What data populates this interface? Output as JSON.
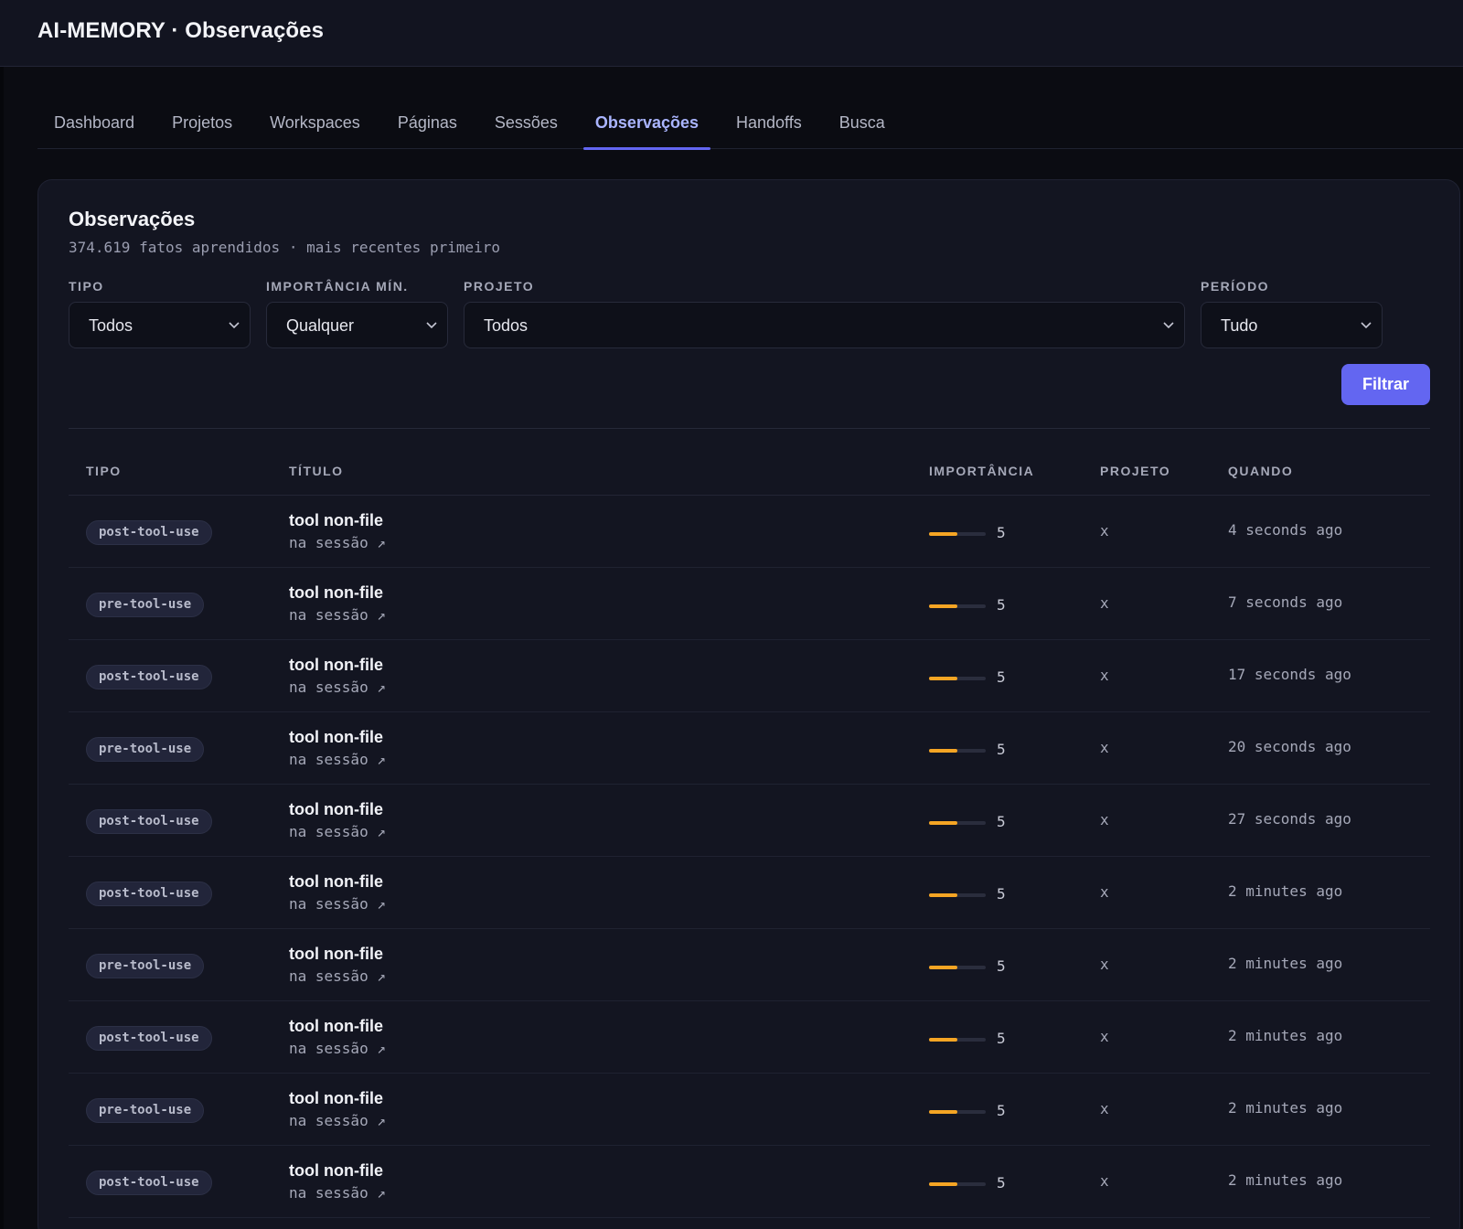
{
  "app": {
    "title": "AI-MEMORY · Observações"
  },
  "tabs": [
    {
      "label": "Dashboard"
    },
    {
      "label": "Projetos"
    },
    {
      "label": "Workspaces"
    },
    {
      "label": "Páginas"
    },
    {
      "label": "Sessões"
    },
    {
      "label": "Observações",
      "active": true
    },
    {
      "label": "Handoffs"
    },
    {
      "label": "Busca"
    }
  ],
  "card": {
    "title": "Observações",
    "subtitle": "374.619 fatos aprendidos · mais recentes primeiro"
  },
  "filters": {
    "tipo": {
      "label": "TIPO",
      "value": "Todos"
    },
    "importancia": {
      "label": "IMPORTÂNCIA MÍN.",
      "value": "Qualquer"
    },
    "projeto": {
      "label": "PROJETO",
      "value": "Todos"
    },
    "periodo": {
      "label": "PERÍODO",
      "value": "Tudo"
    },
    "submit_label": "Filtrar"
  },
  "table": {
    "headers": {
      "tipo": "TIPO",
      "titulo": "TÍTULO",
      "importancia": "IMPORTÂNCIA",
      "projeto": "PROJETO",
      "quando": "QUANDO"
    },
    "rows": [
      {
        "tipo": "post-tool-use",
        "titulo": "tool non-file",
        "sessao": "na sessão ↗",
        "importancia": "5",
        "importancia_fill": 0.5,
        "projeto": "x",
        "quando": "4 seconds ago"
      },
      {
        "tipo": "pre-tool-use",
        "titulo": "tool non-file",
        "sessao": "na sessão ↗",
        "importancia": "5",
        "importancia_fill": 0.5,
        "projeto": "x",
        "quando": "7 seconds ago"
      },
      {
        "tipo": "post-tool-use",
        "titulo": "tool non-file",
        "sessao": "na sessão ↗",
        "importancia": "5",
        "importancia_fill": 0.5,
        "projeto": "x",
        "quando": "17 seconds ago"
      },
      {
        "tipo": "pre-tool-use",
        "titulo": "tool non-file",
        "sessao": "na sessão ↗",
        "importancia": "5",
        "importancia_fill": 0.5,
        "projeto": "x",
        "quando": "20 seconds ago"
      },
      {
        "tipo": "post-tool-use",
        "titulo": "tool non-file",
        "sessao": "na sessão ↗",
        "importancia": "5",
        "importancia_fill": 0.5,
        "projeto": "x",
        "quando": "27 seconds ago"
      },
      {
        "tipo": "post-tool-use",
        "titulo": "tool non-file",
        "sessao": "na sessão ↗",
        "importancia": "5",
        "importancia_fill": 0.5,
        "projeto": "x",
        "quando": "2 minutes ago"
      },
      {
        "tipo": "pre-tool-use",
        "titulo": "tool non-file",
        "sessao": "na sessão ↗",
        "importancia": "5",
        "importancia_fill": 0.5,
        "projeto": "x",
        "quando": "2 minutes ago"
      },
      {
        "tipo": "post-tool-use",
        "titulo": "tool non-file",
        "sessao": "na sessão ↗",
        "importancia": "5",
        "importancia_fill": 0.5,
        "projeto": "x",
        "quando": "2 minutes ago"
      },
      {
        "tipo": "pre-tool-use",
        "titulo": "tool non-file",
        "sessao": "na sessão ↗",
        "importancia": "5",
        "importancia_fill": 0.5,
        "projeto": "x",
        "quando": "2 minutes ago"
      },
      {
        "tipo": "post-tool-use",
        "titulo": "tool non-file",
        "sessao": "na sessão ↗",
        "importancia": "5",
        "importancia_fill": 0.5,
        "projeto": "x",
        "quando": "2 minutes ago"
      }
    ]
  },
  "colors": {
    "accent": "#6366f1",
    "importance_bar": "#f5a524",
    "background": "#0b0c12",
    "card": "#131521"
  },
  "icons": {
    "select": "chevron-down-icon",
    "session_link": "external-link-arrow"
  }
}
